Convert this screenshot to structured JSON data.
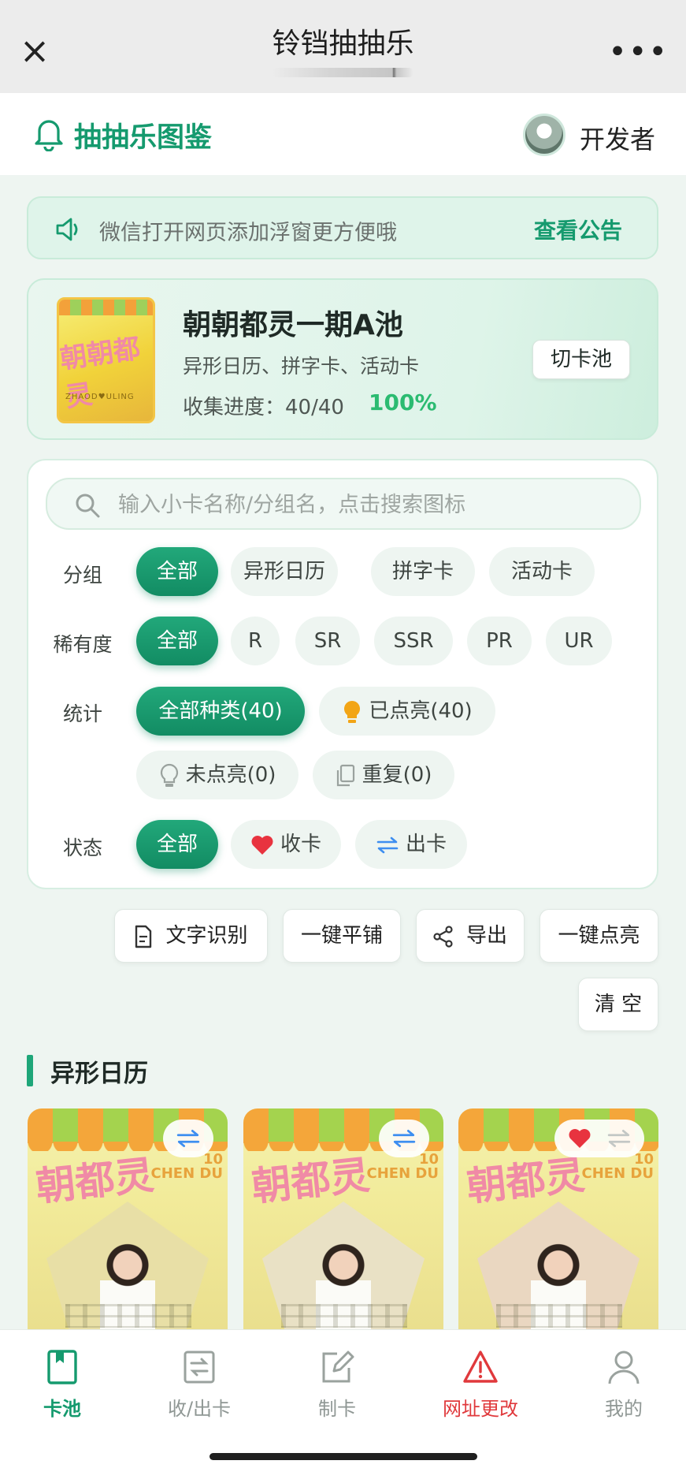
{
  "window": {
    "title": "铃铛抽抽乐",
    "close_icon": "close-icon",
    "more_label": "•••"
  },
  "header": {
    "brand": "抽抽乐图鉴",
    "user": "开发者"
  },
  "notice": {
    "text": "微信打开网页添加浮窗更方便哦",
    "link": "查看公告"
  },
  "pool": {
    "name": "朝朝都灵一期A池",
    "groups": "异形日历、拼字卡、活动卡",
    "progress": "收集进度：40/40",
    "percent": "100%",
    "switch_label": "切卡池",
    "cover_text": "朝朝都灵",
    "cover_sub": "ZHAOD♥ULING"
  },
  "search": {
    "placeholder": "输入小卡名称/分组名，点击搜索图标"
  },
  "filters": {
    "group": {
      "label": "分组",
      "options": [
        "全部",
        "异形日历",
        "拼字卡",
        "活动卡"
      ],
      "selected": "全部"
    },
    "rarity": {
      "label": "稀有度",
      "options": [
        "全部",
        "R",
        "SR",
        "SSR",
        "PR",
        "UR"
      ],
      "selected": "全部"
    },
    "stats": {
      "label": "统计",
      "options": [
        "全部种类(40)",
        "已点亮(40)",
        "未点亮(0)",
        "重复(0)"
      ],
      "selected": "全部种类(40)"
    },
    "status": {
      "label": "状态",
      "options": [
        "全部",
        "收卡",
        "出卡"
      ],
      "selected": "全部"
    }
  },
  "actions": [
    "文字识别",
    "一键平铺",
    "导出",
    "一键点亮",
    "清 空"
  ],
  "section": {
    "title": "异形日历"
  },
  "cards": [
    {
      "script": "朝都灵",
      "num": "10\nCHEN DU",
      "wanted": false,
      "offered": true
    },
    {
      "script": "朝都灵",
      "num": "10\nCHEN DU",
      "wanted": false,
      "offered": true
    },
    {
      "script": "朝都灵",
      "num": "10\nCHEN DU",
      "wanted": true,
      "offered": false
    }
  ],
  "tabbar": [
    {
      "label": "卡池",
      "icon": "bookmark-icon",
      "active": true
    },
    {
      "label": "收/出卡",
      "icon": "exchange-icon",
      "active": false
    },
    {
      "label": "制卡",
      "icon": "edit-icon",
      "active": false
    },
    {
      "label": "网址更改",
      "icon": "warning-icon",
      "active": false
    },
    {
      "label": "我的",
      "icon": "user-icon",
      "active": false
    }
  ],
  "colors": {
    "accent": "#159a6e",
    "accent_gradient_top": "#22a87a",
    "percent": "#2bbb71",
    "warn": "#e0393c",
    "heart": "#e8333f",
    "swap": "#3e8ef0"
  }
}
